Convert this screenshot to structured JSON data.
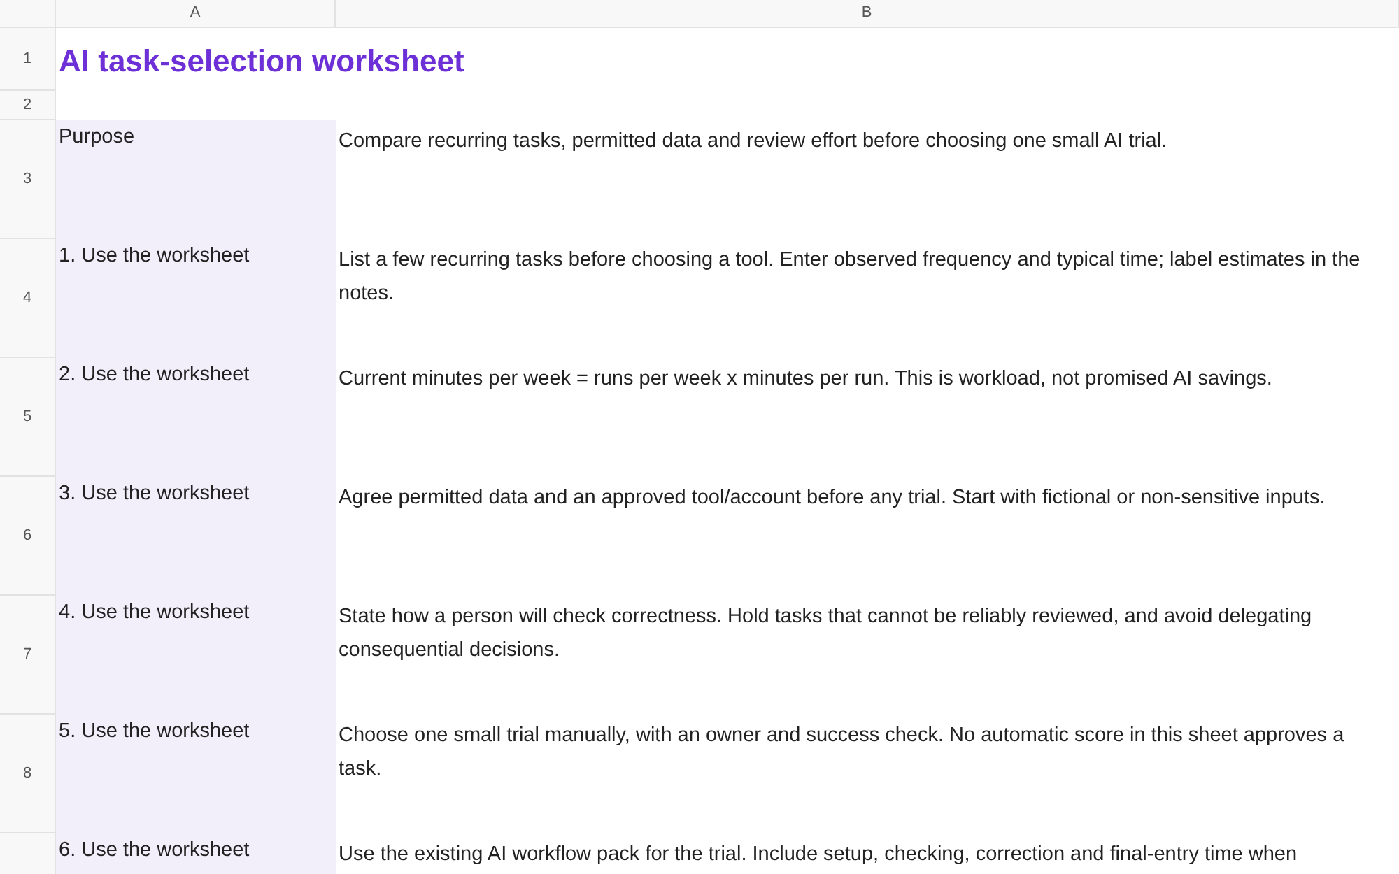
{
  "column_headers": [
    "A",
    "B"
  ],
  "rows": [
    {
      "number": "1",
      "kind": "title",
      "text": "AI task-selection worksheet"
    },
    {
      "number": "2",
      "kind": "blank"
    },
    {
      "number": "3",
      "kind": "entry",
      "label": "Purpose",
      "text": "Compare recurring tasks, permitted data and review effort before choosing one small AI trial."
    },
    {
      "number": "4",
      "kind": "entry",
      "label": "1. Use the worksheet",
      "text": "List a few recurring tasks before choosing a tool. Enter observed frequency and typical time; label estimates in the notes."
    },
    {
      "number": "5",
      "kind": "entry",
      "label": "2. Use the worksheet",
      "text": "Current minutes per week = runs per week x minutes per run. This is workload, not promised AI savings."
    },
    {
      "number": "6",
      "kind": "entry",
      "label": "3. Use the worksheet",
      "text": "Agree permitted data and an approved tool/account before any trial. Start with fictional or non-sensitive inputs."
    },
    {
      "number": "7",
      "kind": "entry",
      "label": "4. Use the worksheet",
      "text": "State how a person will check correctness. Hold tasks that cannot be reliably reviewed, and avoid delegating consequential decisions."
    },
    {
      "number": "8",
      "kind": "entry",
      "label": "5. Use the worksheet",
      "text": "Choose one small trial manually, with an owner and success check. No automatic score in this sheet approves a task."
    },
    {
      "kind": "entry",
      "label": "6. Use the worksheet",
      "text": "Use the existing AI workflow pack for the trial. Include setup, checking, correction and final-entry time when"
    }
  ]
}
